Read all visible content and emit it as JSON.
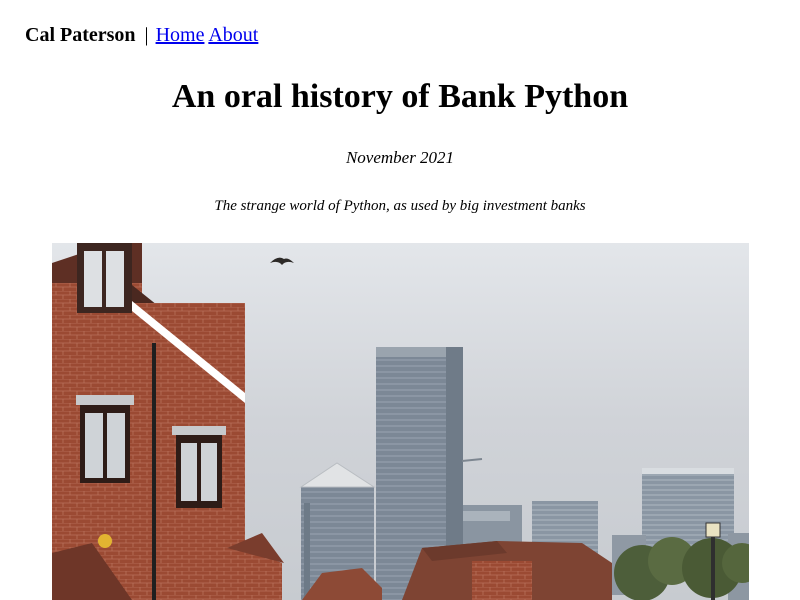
{
  "header": {
    "site_name": "Cal Paterson",
    "separator": "|",
    "nav": [
      {
        "label": "Home"
      },
      {
        "label": "About"
      }
    ]
  },
  "article": {
    "title": "An oral history of Bank Python",
    "date": "November 2021",
    "subtitle": "The strange world of Python, as used by big investment banks"
  },
  "hero_image": {
    "description_colors": {
      "sky": "#d6d9de",
      "brick": "#9a4a32",
      "tower": "#7f8a96",
      "link": "#0000ee"
    }
  }
}
